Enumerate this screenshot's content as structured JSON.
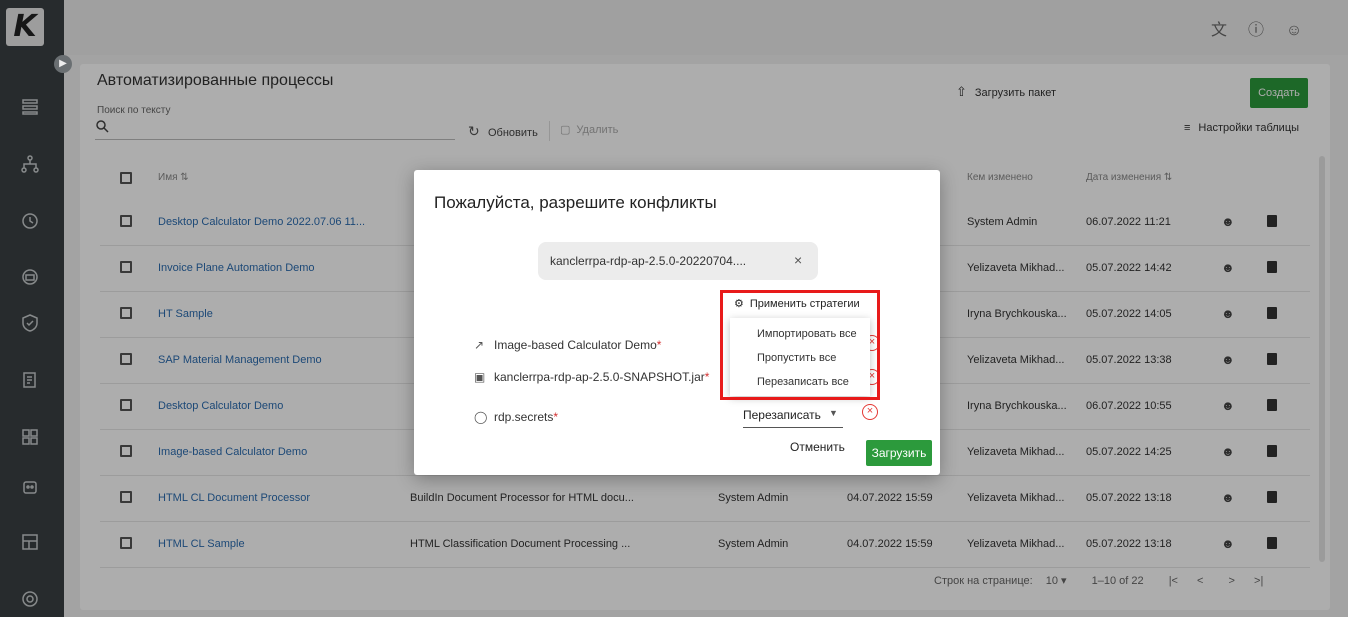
{
  "app": {
    "logo_text": "K"
  },
  "topbar": {
    "icons": [
      "translate-icon",
      "help-icon",
      "user-icon"
    ]
  },
  "page": {
    "title": "Автоматизированные процессы",
    "search_label": "Поиск по тексту",
    "refresh_label": "Обновить",
    "delete_label": "Удалить",
    "upload_label": "Загрузить пакет",
    "create_label": "Создать",
    "table_settings_label": "Настройки таблицы"
  },
  "table": {
    "headers": {
      "name": "Имя",
      "modified_by": "Кем изменено",
      "modified_date": "Дата изменения"
    },
    "rows": [
      {
        "name": "Desktop Calculator Demo 2022.07.06 11...",
        "description": "",
        "author": "",
        "created": "",
        "modified_by": "System Admin",
        "modified_date": "06.07.2022 11:21"
      },
      {
        "name": "Invoice Plane Automation Demo",
        "description": "",
        "author": "",
        "created": "",
        "modified_by": "Yelizaveta Mikhad...",
        "modified_date": "05.07.2022 14:42"
      },
      {
        "name": "HT Sample",
        "description": "",
        "author": "",
        "created": "",
        "modified_by": "Iryna Brychkouska...",
        "modified_date": "05.07.2022 14:05"
      },
      {
        "name": "SAP Material Management Demo",
        "description": "",
        "author": "",
        "created": "",
        "modified_by": "Yelizaveta Mikhad...",
        "modified_date": "05.07.2022 13:38"
      },
      {
        "name": "Desktop Calculator Demo",
        "description": "",
        "author": "",
        "created": "",
        "modified_by": "Iryna Brychkouska...",
        "modified_date": "06.07.2022 10:55"
      },
      {
        "name": "Image-based Calculator Demo",
        "description": "",
        "author": "",
        "created": "",
        "modified_by": "Yelizaveta Mikhad...",
        "modified_date": "05.07.2022 14:25"
      },
      {
        "name": "HTML CL Document Processor",
        "description": "BuildIn Document Processor for HTML docu...",
        "author": "System Admin",
        "created": "04.07.2022 15:59",
        "modified_by": "Yelizaveta Mikhad...",
        "modified_date": "05.07.2022 13:18"
      },
      {
        "name": "HTML CL Sample",
        "description": "HTML Classification Document Processing ...",
        "author": "System Admin",
        "created": "04.07.2022 15:59",
        "modified_by": "Yelizaveta Mikhad...",
        "modified_date": "05.07.2022 13:18"
      }
    ]
  },
  "pagination": {
    "rows_label": "Строк на странице:",
    "rows_value": "10",
    "range": "1–10 of 22"
  },
  "dialog": {
    "title": "Пожалуйста, разрешите конфликты",
    "file_chip": "kanclerrpa-rdp-ap-2.5.0-20220704....",
    "items": [
      {
        "label": "Image-based Calculator Demo",
        "required": "*"
      },
      {
        "label": "kanclerrpa-rdp-ap-2.5.0-SNAPSHOT.jar",
        "required": "*"
      },
      {
        "label": "rdp.secrets",
        "required": "*"
      }
    ],
    "select_value": "Перезаписать",
    "cancel_label": "Отменить",
    "load_label": "Загрузить"
  },
  "strategy": {
    "head_label": "Применить стратегии",
    "items": [
      "Импортировать все",
      "Пропустить все",
      "Перезаписать все"
    ]
  }
}
